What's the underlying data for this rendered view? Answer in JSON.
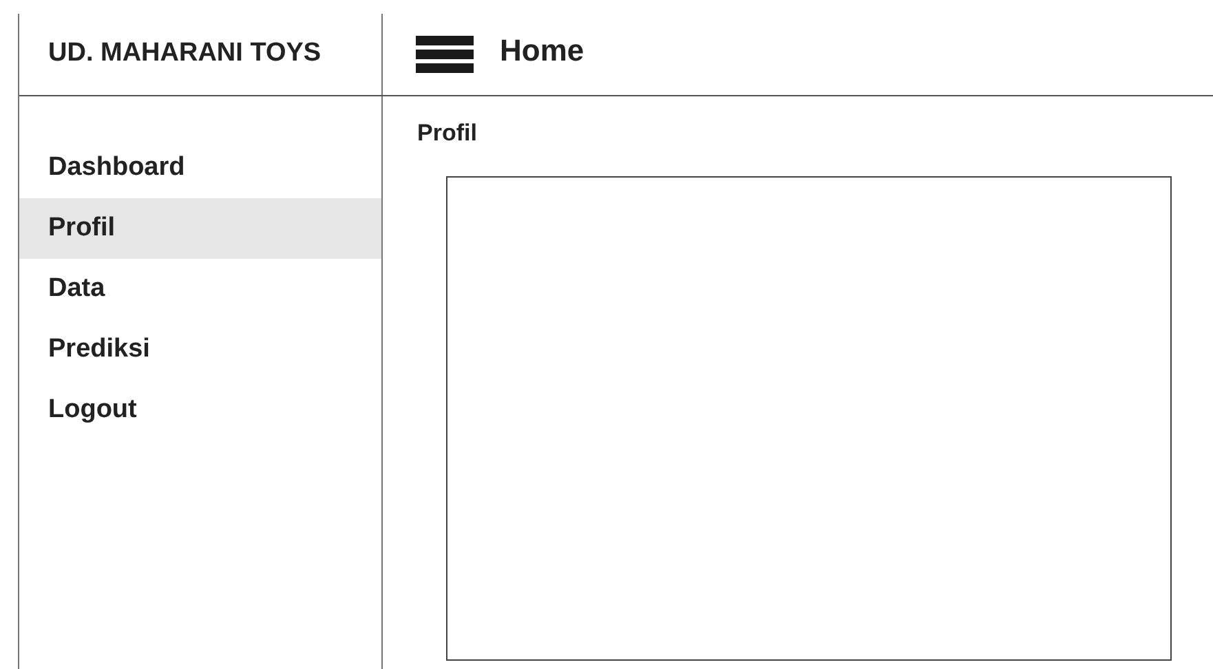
{
  "brand": "UD. MAHARANI TOYS",
  "header": {
    "title": "Home"
  },
  "sidebar": {
    "items": [
      {
        "label": "Dashboard",
        "selected": false
      },
      {
        "label": "Profil",
        "selected": true
      },
      {
        "label": "Data",
        "selected": false
      },
      {
        "label": "Prediksi",
        "selected": false
      },
      {
        "label": "Logout",
        "selected": false
      }
    ]
  },
  "content": {
    "title": "Profil"
  }
}
